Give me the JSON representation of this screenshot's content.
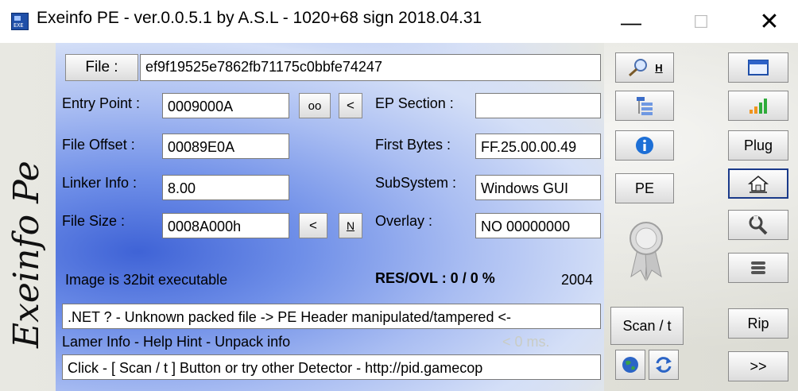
{
  "window": {
    "title": "Exeinfo PE - ver.0.0.5.1  by A.S.L -  1020+68 sign  2018.04.31",
    "icon_text": "EXE",
    "minimize": "—",
    "maximize": "☐",
    "close": "✕"
  },
  "side_logo": "Exeinfo Pe",
  "file": {
    "button_label": "File :",
    "value": "ef9f19525e7862fb71175c0bbfe74247"
  },
  "entry_point": {
    "label": "Entry Point :",
    "value": "0009000A",
    "oo_label": "oo",
    "back_label": "<"
  },
  "ep_section": {
    "label": "EP Section :",
    "value": ""
  },
  "file_offset": {
    "label": "File Offset :",
    "value": "00089E0A"
  },
  "first_bytes": {
    "label": "First Bytes :",
    "value": "FF.25.00.00.49"
  },
  "linker_info": {
    "label": "Linker Info :",
    "value": "8.00"
  },
  "subsystem": {
    "label": "SubSystem :",
    "value": "Windows GUI"
  },
  "file_size": {
    "label": "File Size :",
    "value": "0008A000h",
    "back_label": "<",
    "n_label": "N"
  },
  "overlay": {
    "label": "Overlay :",
    "value": "NO   00000000"
  },
  "image_info": "Image is 32bit executable",
  "res_ovl": {
    "label": "RES/OVL : 0 / 0 %",
    "value": "2004"
  },
  "result": ".NET ? - Unknown packed file -> PE Header manipulated/tampered <-",
  "lamer_info": "Lamer Info - Help Hint - Unpack info",
  "time_label": "< 0 ms.",
  "hint": "Click - [ Scan / t ]  Button  or  try other Detector -   http://pid.gamecop",
  "middle_buttons": {
    "search_hotkey": "H",
    "pe": "PE",
    "scan": "Scan / t"
  },
  "right_buttons": {
    "plug": "Plug",
    "rip": "Rip",
    "more": ">>"
  },
  "colors": {
    "accent_blue": "#3f63d6",
    "info_blue": "#1d6fd6",
    "bars_orange": "#f0941e",
    "bars_green": "#2eab3a"
  }
}
